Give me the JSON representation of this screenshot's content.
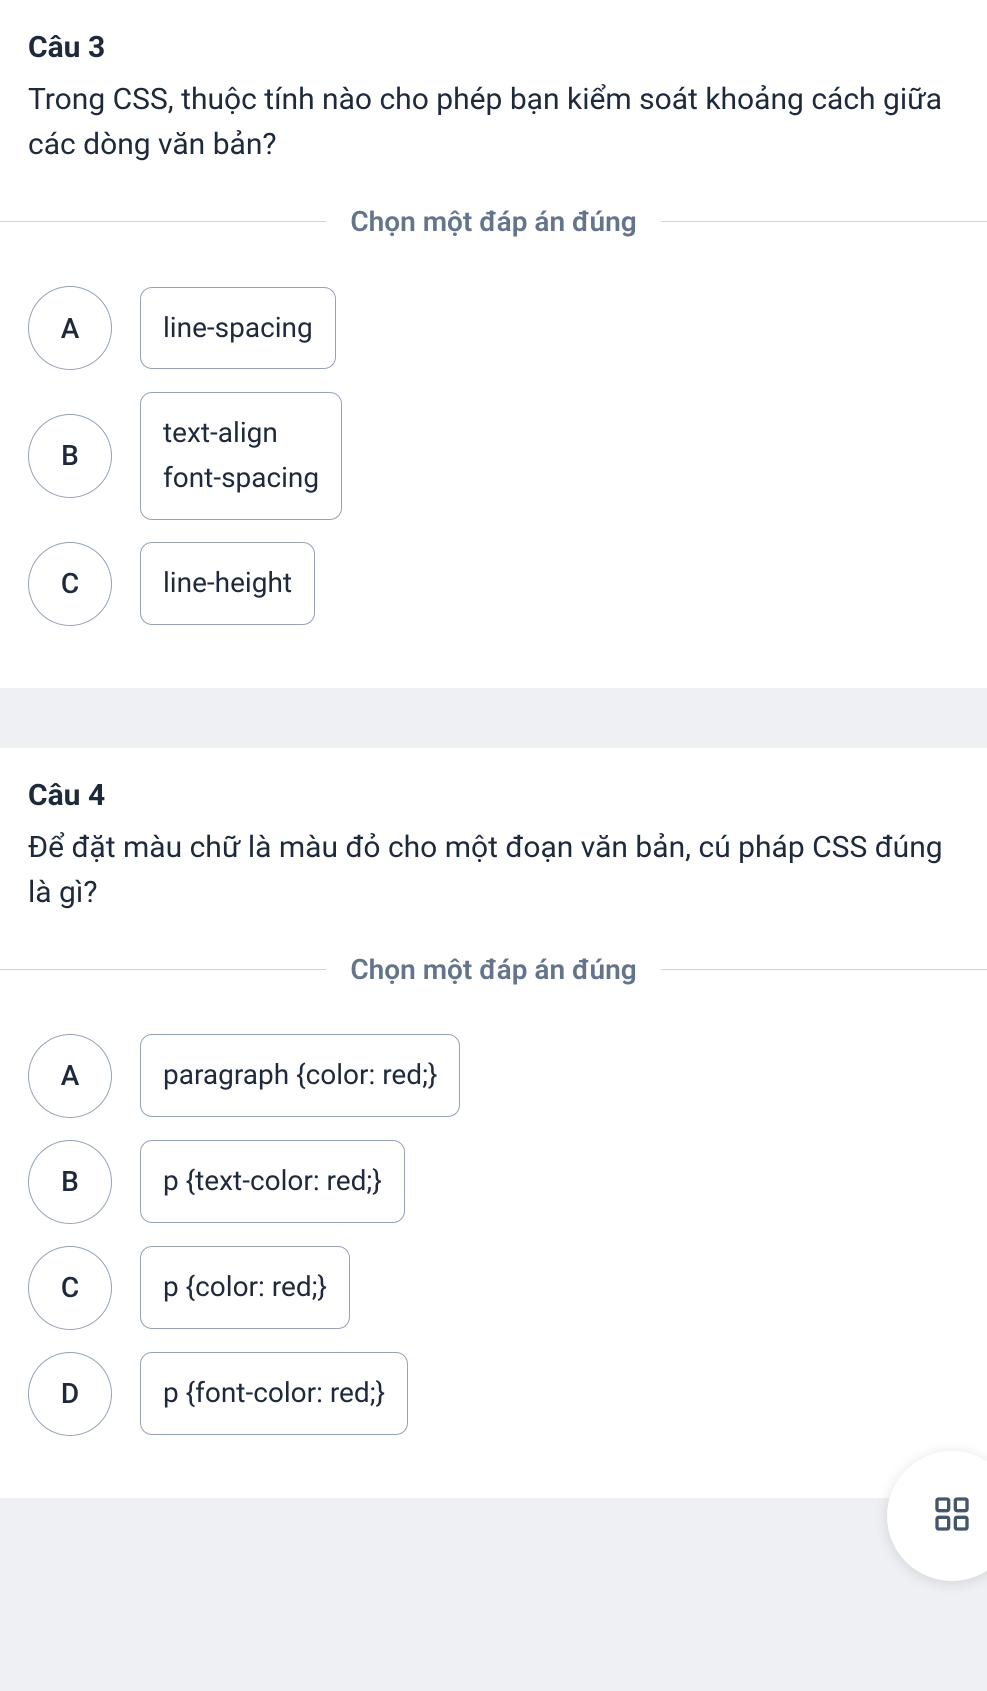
{
  "instruction": "Chọn một đáp án đúng",
  "questions": [
    {
      "title": "Câu 3",
      "text": "Trong CSS, thuộc tính nào cho phép bạn kiểm soát khoảng cách giữa các dòng văn bản?",
      "options": [
        {
          "letter": "A",
          "answer": "line-spacing"
        },
        {
          "letter": "B",
          "answer": "text-align\nfont-spacing"
        },
        {
          "letter": "C",
          "answer": "line-height"
        }
      ]
    },
    {
      "title": "Câu 4",
      "text": "Để đặt màu chữ là màu đỏ cho một đoạn văn bản, cú pháp CSS đúng là gì?",
      "options": [
        {
          "letter": "A",
          "answer": "paragraph {color: red;}"
        },
        {
          "letter": "B",
          "answer": "p {text-color: red;}"
        },
        {
          "letter": "C",
          "answer": "p {color: red;}"
        },
        {
          "letter": "D",
          "answer": "p {font-color: red;}"
        }
      ]
    }
  ]
}
